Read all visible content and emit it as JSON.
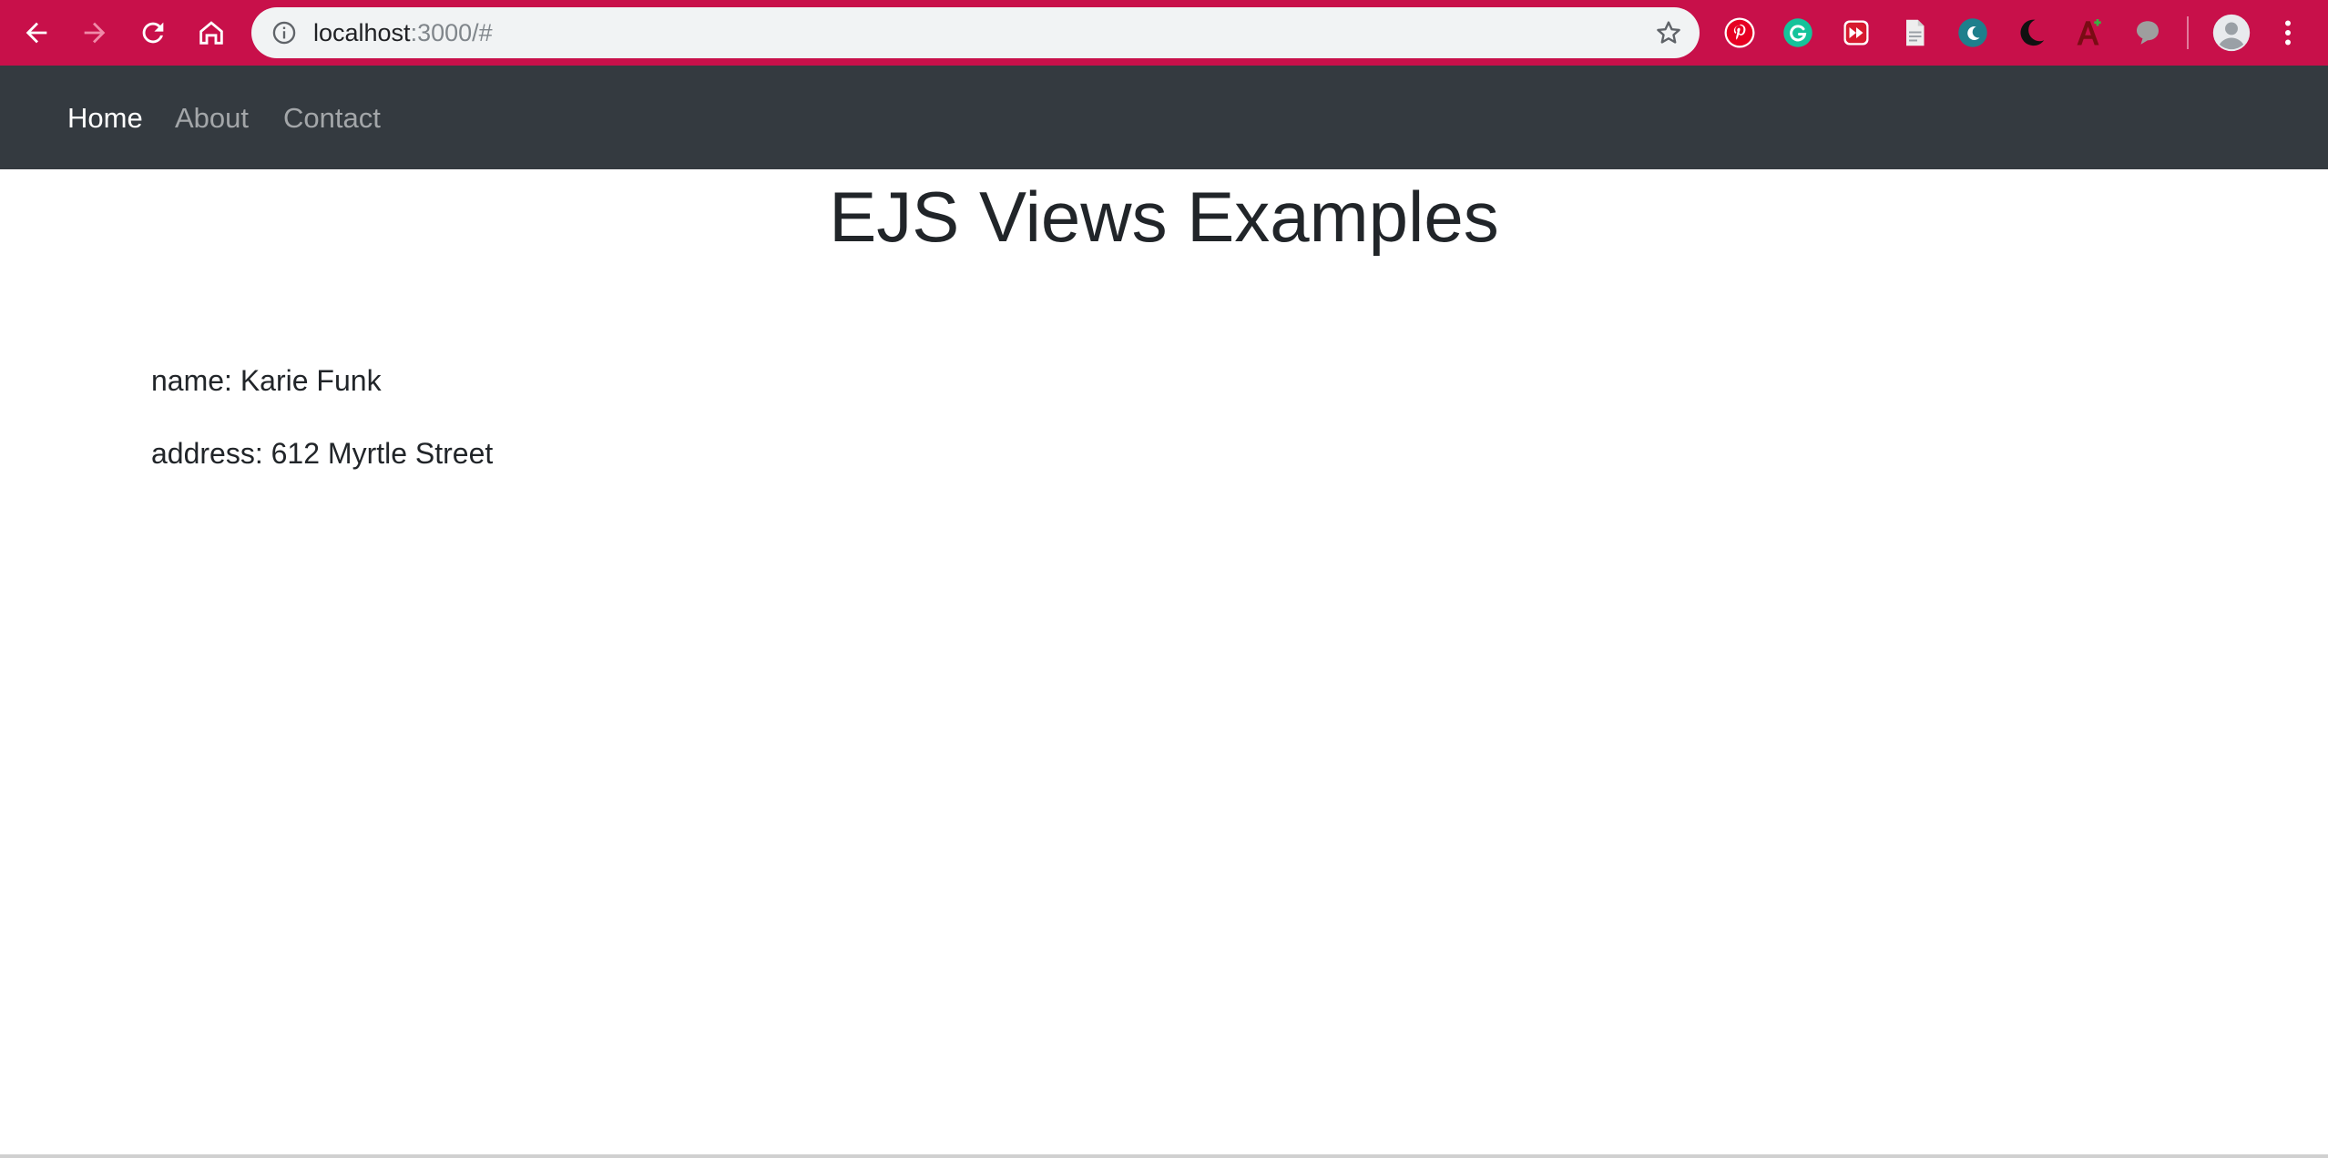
{
  "browser": {
    "url_host": "localhost",
    "url_rest": ":3000/#",
    "icons": {
      "back": "back-arrow-icon",
      "forward": "forward-arrow-icon",
      "reload": "reload-icon",
      "home": "home-icon",
      "info": "info-icon",
      "bookmark": "bookmark-star-icon",
      "menu": "kebab-menu-icon",
      "profile": "profile-avatar-icon"
    },
    "extensions": [
      "pinterest-icon",
      "grammarly-icon",
      "media-extension-icon",
      "document-icon",
      "dark-reader-icon",
      "night-mode-icon",
      "adobe-icon",
      "chat-icon"
    ],
    "chrome_color": "#c8104a"
  },
  "navbar": {
    "items": [
      {
        "label": "Home",
        "active": true
      },
      {
        "label": "About",
        "active": false
      },
      {
        "label": "Contact",
        "active": false
      }
    ],
    "background": "#343a40"
  },
  "main": {
    "title": "EJS Views Examples",
    "fields": [
      {
        "text": "name: Karie Funk"
      },
      {
        "text": "address: 612 Myrtle Street"
      }
    ]
  }
}
